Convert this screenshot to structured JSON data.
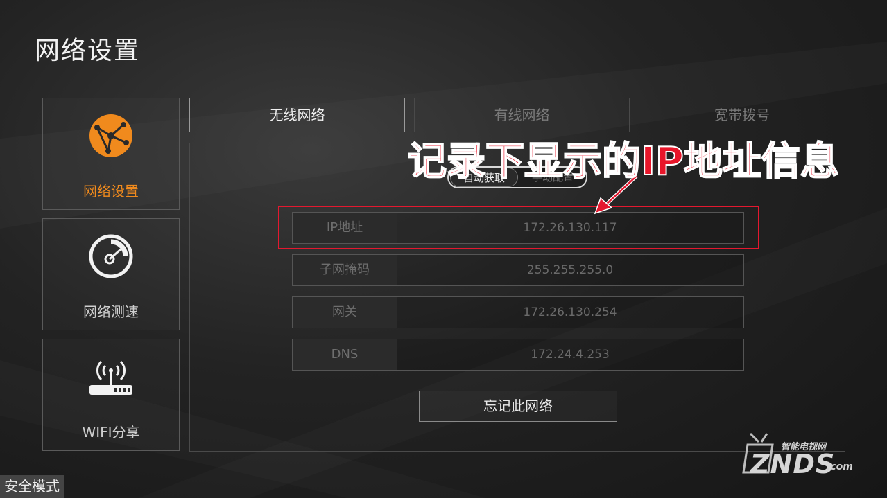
{
  "page": {
    "title": "网络设置"
  },
  "sidebar": {
    "items": [
      {
        "label": "网络设置",
        "icon": "network-globe-icon",
        "active": true
      },
      {
        "label": "网络测速",
        "icon": "speedometer-icon",
        "active": false
      },
      {
        "label": "WIFI分享",
        "icon": "wifi-router-icon",
        "active": false
      }
    ]
  },
  "tabs": [
    {
      "label": "无线网络",
      "active": true
    },
    {
      "label": "有线网络",
      "active": false
    },
    {
      "label": "宽带拨号",
      "active": false
    }
  ],
  "mode_toggle": {
    "auto": "自动获取",
    "manual": "手动配置",
    "selected": "自动获取"
  },
  "fields": [
    {
      "label": "IP地址",
      "value": "172.26.130.117"
    },
    {
      "label": "子网掩码",
      "value": "255.255.255.0"
    },
    {
      "label": "网关",
      "value": "172.26.130.254"
    },
    {
      "label": "DNS",
      "value": "172.24.4.253"
    }
  ],
  "forget_button": "忘记此网络",
  "annotation": "记录下显示的IP地址信息",
  "status": {
    "safe_mode": "安全模式"
  },
  "watermark": {
    "top": "智能电视网",
    "main": "ZNDS",
    "suffix": ".com"
  },
  "colors": {
    "accent": "#f08a1d",
    "annotation_red": "#e8162a"
  }
}
